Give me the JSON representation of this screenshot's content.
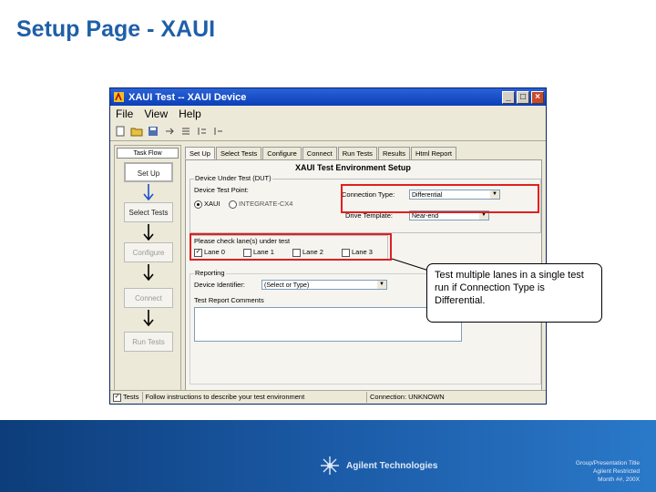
{
  "slide": {
    "title": "Setup Page - XAUI"
  },
  "window": {
    "title": "XAUI Test -- XAUI Device",
    "menu": [
      "File",
      "View",
      "Help"
    ]
  },
  "left_panel": {
    "header": "Task Flow",
    "steps": [
      {
        "label": "Set Up",
        "state": "active"
      },
      {
        "label": "Select Tests",
        "state": "enabled"
      },
      {
        "label": "Configure",
        "state": "disabled"
      },
      {
        "label": "Connect",
        "state": "disabled"
      },
      {
        "label": "Run Tests",
        "state": "disabled"
      }
    ]
  },
  "tabs": [
    "Set Up",
    "Select Tests",
    "Configure",
    "Connect",
    "Run Tests",
    "Results",
    "Html Report"
  ],
  "setup": {
    "env_title": "XAUI Test Environment Setup",
    "dut_group": "Device Under Test (DUT)",
    "dut_form_label": "Device Test Point:",
    "radio_xaui": "XAUI",
    "radio_xfp": "INTEGRATE-CX4",
    "connection_type_label": "Connection Type:",
    "connection_type_value": "Differential",
    "drive_template_label": "Drive Template:",
    "drive_template_value": "Near-end",
    "lanes_label": "Please check lane(s) under test",
    "lanes": [
      {
        "label": "Lane 0",
        "checked": true
      },
      {
        "label": "Lane 1",
        "checked": false
      },
      {
        "label": "Lane 2",
        "checked": false
      },
      {
        "label": "Lane 3",
        "checked": false
      }
    ],
    "reporting_group": "Reporting",
    "device_identifier_label": "Device Identifier:",
    "device_identifier_value": "(Select or Type)",
    "report_comments_label": "Test Report Comments"
  },
  "status": {
    "tests": "Tests",
    "message": "Follow instructions to describe your test environment",
    "connection": "Connection: UNKNOWN"
  },
  "callout": {
    "text": "Test multiple lanes in a single test run if Connection Type is Differential."
  },
  "footer": {
    "brand": "Agilent Technologies",
    "line1": "Group/Presentation Title",
    "line2": "Agilent Restricted",
    "line3": "Month ##, 200X"
  },
  "colors": {
    "title_blue": "#1f5fa8",
    "highlight_red": "#e02020",
    "footer_dark": "#0d3d7a"
  }
}
